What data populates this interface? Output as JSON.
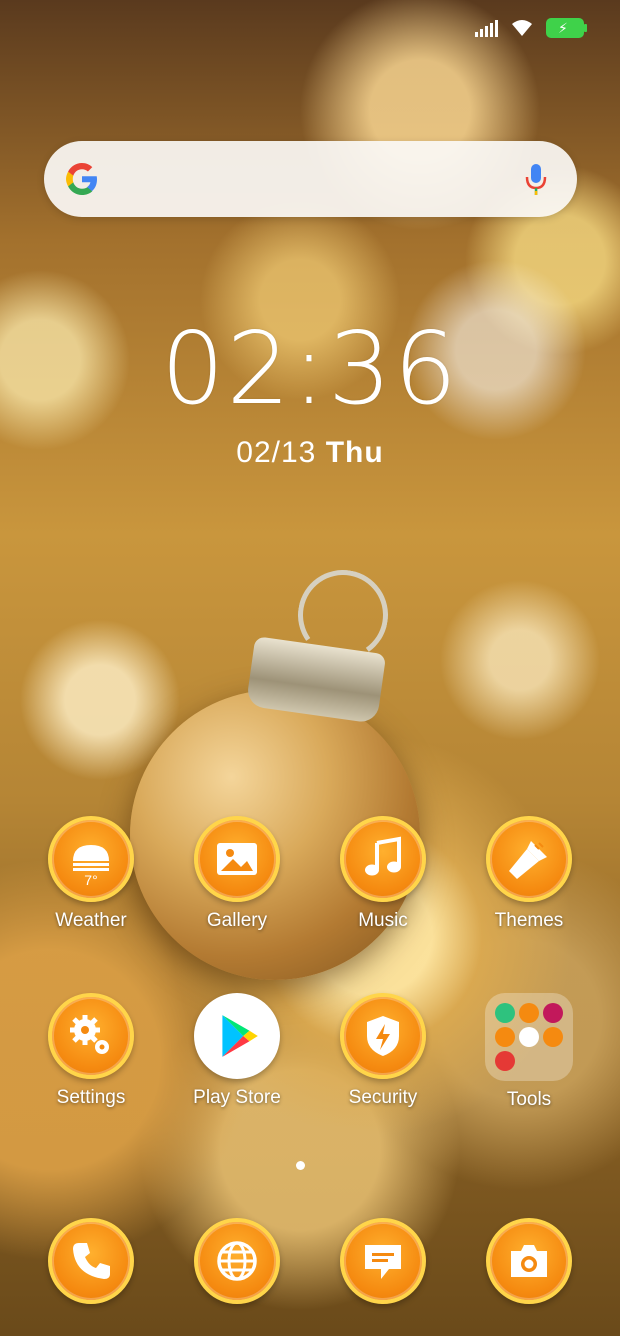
{
  "status_bar": {
    "signal_icon": "signal-icon",
    "wifi_icon": "wifi-icon",
    "battery_icon": "battery-charging-icon",
    "battery_color": "#3fd24a"
  },
  "search": {
    "logo": "google-logo-icon",
    "mic": "mic-icon"
  },
  "clock": {
    "time": "02:36",
    "date_prefix": "02/13",
    "weekday": "Thu"
  },
  "apps": [
    {
      "label": "Weather",
      "icon": "weather-icon",
      "temp": "7°"
    },
    {
      "label": "Gallery",
      "icon": "gallery-icon"
    },
    {
      "label": "Music",
      "icon": "music-note-icon"
    },
    {
      "label": "Themes",
      "icon": "paintbrush-icon"
    },
    {
      "label": "Settings",
      "icon": "gear-icon"
    },
    {
      "label": "Play Store",
      "icon": "play-store-icon"
    },
    {
      "label": "Security",
      "icon": "security-shield-icon"
    },
    {
      "label": "Tools",
      "icon": "folder-icon"
    }
  ],
  "dock": [
    {
      "icon": "phone-icon"
    },
    {
      "icon": "browser-globe-icon"
    },
    {
      "icon": "messages-icon"
    },
    {
      "icon": "camera-icon"
    }
  ],
  "colors": {
    "icon_orange": "#f58a10",
    "icon_ring": "#ffd54a"
  }
}
